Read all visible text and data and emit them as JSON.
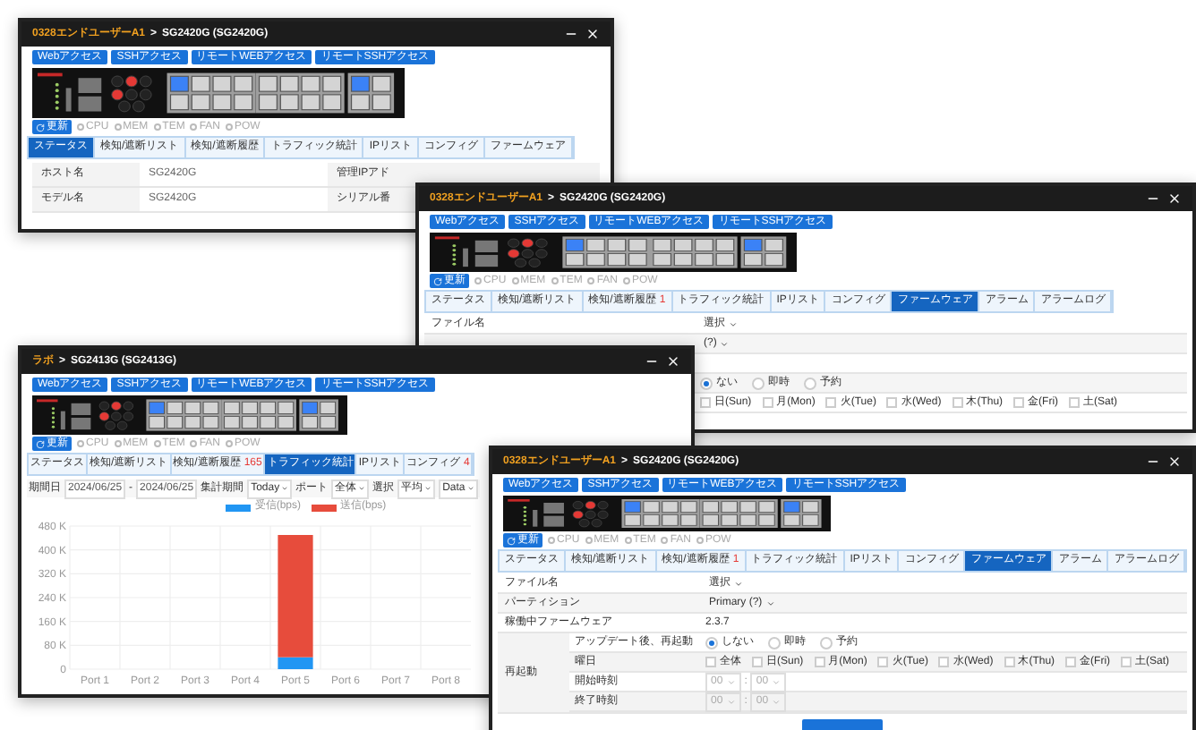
{
  "windows": [
    {
      "kind": "status",
      "title_org": "0328エンドユーザーA1",
      "title_sep": ">",
      "title_device": "SG2420G (SG2420G)",
      "access_buttons": [
        "Webアクセス",
        "SSHアクセス",
        "リモートWEBアクセス",
        "リモートSSHアクセス"
      ],
      "refresh": "更新",
      "indicators": [
        "CPU",
        "MEM",
        "TEM",
        "FAN",
        "POW"
      ],
      "tabs": [
        {
          "label": "ステータス",
          "selected": true
        },
        {
          "label": "検知/遮断リスト",
          "selected": false
        },
        {
          "label": "検知/遮断履歴",
          "selected": false
        },
        {
          "label": "トラフィック統計",
          "selected": false
        },
        {
          "label": "IPリスト",
          "selected": false
        },
        {
          "label": "コンフィグ",
          "selected": false
        },
        {
          "label": "ファームウェア",
          "selected": false
        }
      ],
      "info_rows": [
        {
          "cells": [
            "ホスト名",
            "SG2420G",
            "管理IPアド"
          ]
        },
        {
          "cells": [
            "モデル名",
            "SG2420G",
            "シリアル番"
          ]
        }
      ]
    },
    {
      "kind": "firmware",
      "title_org": "0328エンドユーザーA1",
      "title_sep": ">",
      "title_device": "SG2420G (SG2420G)",
      "access_buttons": [
        "Webアクセス",
        "SSHアクセス",
        "リモートWEBアクセス",
        "リモートSSHアクセス"
      ],
      "refresh": "更新",
      "indicators": [
        "CPU",
        "MEM",
        "TEM",
        "FAN",
        "POW"
      ],
      "tabs": [
        {
          "label": "ステータス",
          "selected": false
        },
        {
          "label": "検知/遮断リスト",
          "selected": false
        },
        {
          "label": "検知/遮断履歴",
          "badge": "1",
          "selected": false
        },
        {
          "label": "トラフィック統計",
          "selected": false
        },
        {
          "label": "IPリスト",
          "selected": false
        },
        {
          "label": "コンフィグ",
          "selected": false
        },
        {
          "label": "ファームウェア",
          "selected": true
        },
        {
          "label": "アラーム",
          "selected": false
        },
        {
          "label": "アラームログ",
          "selected": false
        }
      ],
      "rows": [
        {
          "kind": "select",
          "label": "ファイル名",
          "value": "選択"
        },
        {
          "kind": "select",
          "value": "(?)"
        },
        {
          "kind": "blank"
        },
        {
          "kind": "radio",
          "options": [
            {
              "label": "ない",
              "selected": true
            },
            {
              "label": "即時",
              "selected": false
            },
            {
              "label": "予約",
              "selected": false
            }
          ]
        },
        {
          "kind": "days",
          "options": [
            {
              "label": "日(Sun)",
              "checked": false
            },
            {
              "label": "月(Mon)",
              "checked": false
            },
            {
              "label": "火(Tue)",
              "checked": false
            },
            {
              "label": "水(Wed)",
              "checked": false
            },
            {
              "label": "木(Thu)",
              "checked": false
            },
            {
              "label": "金(Fri)",
              "checked": false
            },
            {
              "label": "土(Sat)",
              "checked": false
            }
          ]
        }
      ]
    },
    {
      "kind": "traffic",
      "title_org": "ラボ",
      "title_sep": ">",
      "title_device": "SG2413G (SG2413G)",
      "access_buttons": [
        "Webアクセス",
        "SSHアクセス",
        "リモートWEBアクセス",
        "リモートSSHアクセス"
      ],
      "refresh": "更新",
      "indicators": [
        "CPU",
        "MEM",
        "TEM",
        "FAN",
        "POW"
      ],
      "tabs": [
        {
          "label": "ステータス",
          "selected": false
        },
        {
          "label": "検知/遮断リスト",
          "selected": false
        },
        {
          "label": "検知/遮断履歴",
          "badge": "165",
          "selected": false
        },
        {
          "label": "トラフィック統計",
          "selected": true
        },
        {
          "label": "IPリスト",
          "selected": false
        },
        {
          "label": "コンフィグ",
          "badge": "4",
          "selected": false
        }
      ],
      "filters": [
        {
          "kind": "label",
          "text": "期間日"
        },
        {
          "kind": "date",
          "value": "2024/06/25"
        },
        {
          "kind": "label",
          "text": "-"
        },
        {
          "kind": "date",
          "value": "2024/06/25"
        },
        {
          "kind": "label",
          "text": "集計期間"
        },
        {
          "kind": "select",
          "value": "Today"
        },
        {
          "kind": "label",
          "text": "ポート"
        },
        {
          "kind": "select",
          "value": "全体"
        },
        {
          "kind": "label",
          "text": "選択"
        },
        {
          "kind": "select",
          "value": "平均"
        },
        {
          "kind": "select",
          "value": "Data"
        }
      ],
      "chart_data": {
        "type": "bar",
        "stacked": true,
        "grid": true,
        "legend": true,
        "categories": [
          "Port 1",
          "Port 2",
          "Port 3",
          "Port 4",
          "Port 5",
          "Port 6",
          "Port 7",
          "Port 8"
        ],
        "series": [
          {
            "name": "受信(bps)",
            "color": "#2196f3",
            "values": [
              0,
              0,
              0,
              0,
              40,
              0,
              0,
              0
            ]
          },
          {
            "name": "送信(bps)",
            "color": "#e74c3c",
            "values": [
              0,
              0,
              0,
              0,
              410,
              0,
              0,
              0
            ]
          }
        ],
        "ylim": [
          0,
          480
        ],
        "yticks": [
          {
            "value": 0,
            "label": "0"
          },
          {
            "value": 80,
            "label": "80 K"
          },
          {
            "value": 160,
            "label": "160 K"
          },
          {
            "value": 240,
            "label": "240 K"
          },
          {
            "value": 320,
            "label": "320 K"
          },
          {
            "value": 400,
            "label": "400 K"
          },
          {
            "value": 480,
            "label": "480 K"
          }
        ]
      }
    },
    {
      "kind": "firmware",
      "title_org": "0328エンドユーザーA1",
      "title_sep": ">",
      "title_device": "SG2420G (SG2420G)",
      "access_buttons": [
        "Webアクセス",
        "SSHアクセス",
        "リモートWEBアクセス",
        "リモートSSHアクセス"
      ],
      "refresh": "更新",
      "indicators": [
        "CPU",
        "MEM",
        "TEM",
        "FAN",
        "POW"
      ],
      "tabs": [
        {
          "label": "ステータス",
          "selected": false
        },
        {
          "label": "検知/遮断リスト",
          "selected": false
        },
        {
          "label": "検知/遮断履歴",
          "badge": "1",
          "selected": false
        },
        {
          "label": "トラフィック統計",
          "selected": false
        },
        {
          "label": "IPリスト",
          "selected": false
        },
        {
          "label": "コンフィグ",
          "selected": false
        },
        {
          "label": "ファームウェア",
          "selected": true
        },
        {
          "label": "アラーム",
          "selected": false
        },
        {
          "label": "アラームログ",
          "selected": false
        }
      ],
      "rows": [
        {
          "kind": "select",
          "label": "ファイル名",
          "value": "選択"
        },
        {
          "kind": "select",
          "label": "パーティション",
          "value": "Primary (?)"
        },
        {
          "kind": "text",
          "label": "稼働中ファームウェア",
          "value": "2.3.7"
        },
        {
          "kind": "group",
          "label": "再起動",
          "children": [
            {
              "kind": "radio",
              "label": "アップデート後、再起動",
              "options": [
                {
                  "label": "しない",
                  "selected": true
                },
                {
                  "label": "即時",
                  "selected": false
                },
                {
                  "label": "予約",
                  "selected": false
                }
              ]
            },
            {
              "kind": "days",
              "label": "曜日",
              "options": [
                {
                  "label": "全体",
                  "checked": false
                },
                {
                  "label": "日(Sun)",
                  "checked": false
                },
                {
                  "label": "月(Mon)",
                  "checked": false
                },
                {
                  "label": "火(Tue)",
                  "checked": false
                },
                {
                  "label": "水(Wed)",
                  "checked": false
                },
                {
                  "label": "木(Thu)",
                  "checked": false
                },
                {
                  "label": "金(Fri)",
                  "checked": false
                },
                {
                  "label": "土(Sat)",
                  "checked": false
                }
              ]
            },
            {
              "kind": "time",
              "label": "開始時刻",
              "hour": "00",
              "sep": ":",
              "minute": "00",
              "disabled": true
            },
            {
              "kind": "time",
              "label": "終了時刻",
              "hour": "00",
              "sep": ":",
              "minute": "00",
              "disabled": true
            }
          ]
        },
        {
          "kind": "submit"
        }
      ]
    }
  ]
}
